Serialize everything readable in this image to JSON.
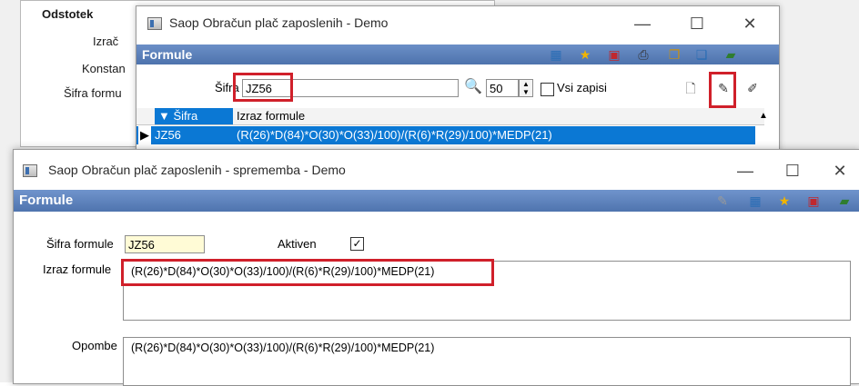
{
  "background_form": {
    "group_title": "Odstotek",
    "labels": [
      "Izrač",
      "Konstan",
      "Šifra formu"
    ]
  },
  "list_window": {
    "title": "Saop Obračun plač zaposlenih - Demo",
    "header": "Formule",
    "search_label": "Šifra",
    "search_value": "JZ56",
    "page_size": "50",
    "all_records_label": "Vsi zapisi",
    "columns": [
      "▼ Šifra",
      "Izraz formule"
    ],
    "rows": [
      {
        "code": "JZ56",
        "expression": "(R(26)*D(84)*O(30)*O(33)/100)/(R(6)*R(29)/100)*MEDP(21)"
      }
    ],
    "controls": {
      "minimize": "—",
      "maximize": "☐",
      "close": "✕"
    }
  },
  "edit_window": {
    "title": "Saop Obračun plač zaposlenih - sprememba - Demo",
    "header": "Formule",
    "code_label": "Šifra formule",
    "code_value": "JZ56",
    "active_label": "Aktiven",
    "active_checked": "✓",
    "expression_label": "Izraz formule",
    "expression_value": "(R(26)*D(84)*O(30)*O(33)/100)/(R(6)*R(29)/100)*MEDP(21)",
    "notes_label": "Opombe",
    "notes_value": "(R(26)*D(84)*O(30)*O(33)/100)/(R(6)*R(29)/100)*MEDP(21)",
    "controls": {
      "minimize": "—",
      "maximize": "☐",
      "close": "✕"
    }
  },
  "colors": {
    "header_blue": "#5a7fba",
    "selection_blue": "#0b78d4",
    "highlight_red": "#d0202a"
  }
}
